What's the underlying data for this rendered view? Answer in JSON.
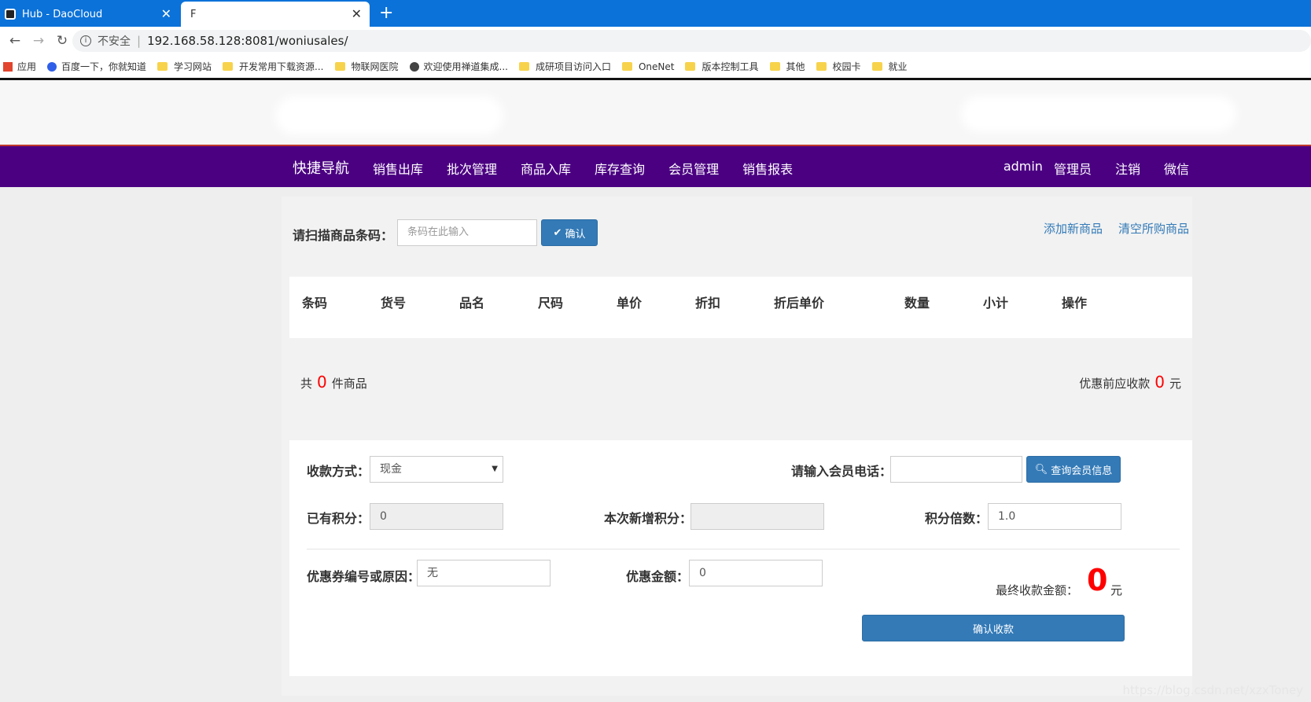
{
  "browser": {
    "tabs": [
      {
        "title": "Hub - DaoCloud"
      },
      {
        "title": "F"
      }
    ],
    "url": "192.168.58.128:8081/woniusales/",
    "security_text": "不安全",
    "bookmarks": [
      "应用",
      "百度一下，你就知道",
      "学习网站",
      "开发常用下载资源...",
      "物联网医院",
      "欢迎使用禅道集成...",
      "成研项目访问入口",
      "OneNet",
      "版本控制工具",
      "其他",
      "校园卡",
      "就业"
    ]
  },
  "nav": {
    "brand": "快捷导航",
    "links": [
      "销售出库",
      "批次管理",
      "商品入库",
      "库存查询",
      "会员管理",
      "销售报表"
    ],
    "user": "admin",
    "role": "管理员",
    "logout": "注销",
    "wechat": "微信"
  },
  "scan": {
    "label": "请扫描商品条码：",
    "placeholder": "条码在此输入",
    "confirm": "确认",
    "add_product": "添加新商品",
    "clear_cart": "清空所购商品"
  },
  "table": {
    "headers": [
      "条码",
      "货号",
      "品名",
      "尺码",
      "单价",
      "折扣",
      "折后单价",
      "数量",
      "小计",
      "操作"
    ]
  },
  "summary": {
    "prefix": "共",
    "count": "0",
    "suffix": "件商品",
    "pre_discount_label": "优惠前应收款",
    "pre_discount_value": "0",
    "unit": "元"
  },
  "payment": {
    "method_label": "收款方式：",
    "method_value": "现金",
    "phone_label": "请输入会员电话：",
    "phone_value": "",
    "query_button": "查询会员信息",
    "points_label": "已有积分：",
    "points_value": "0",
    "new_points_label": "本次新增积分：",
    "new_points_value": "",
    "multiplier_label": "积分倍数：",
    "multiplier_value": "1.0",
    "coupon_label": "优惠券编号或原因：",
    "coupon_value": "无",
    "discount_label": "优惠金额：",
    "discount_value": "0",
    "final_label": "最终收款金额：",
    "final_value": "0",
    "final_unit": "元",
    "collect_button": "确认收款"
  },
  "watermark": "https://blog.csdn.net/xzxToney"
}
